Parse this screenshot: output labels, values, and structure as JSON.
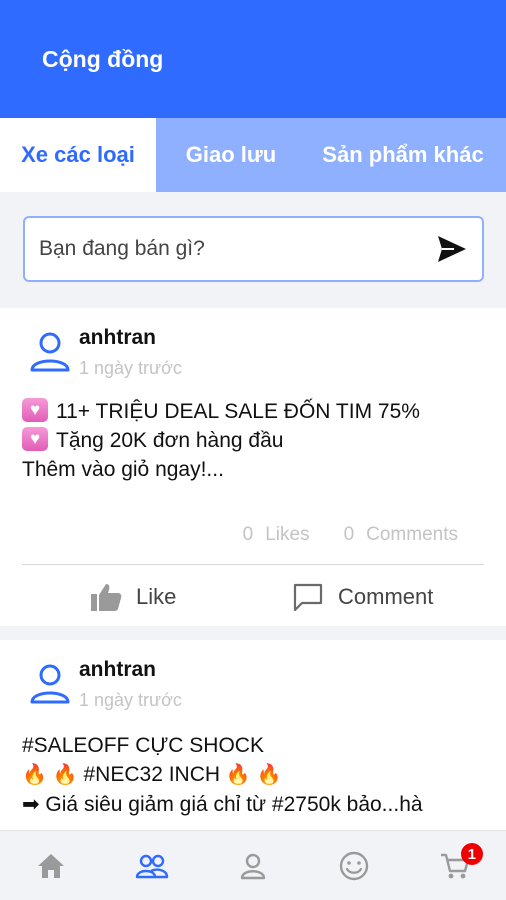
{
  "header": {
    "title": "Cộng đồng"
  },
  "tabs": [
    {
      "label": "Xe các loại",
      "active": true
    },
    {
      "label": "Giao lưu",
      "active": false
    },
    {
      "label": "Sản phẩm khác",
      "active": false
    }
  ],
  "composer": {
    "placeholder": "Bạn đang bán gì?",
    "send_icon": "send-icon"
  },
  "posts": [
    {
      "author": "anhtran",
      "time": "1 ngày trước",
      "lines": [
        "11+ TRIỆU DEAL SALE ĐỐN TIM 75%",
        "Tặng 20K đơn hàng đầu",
        "Thêm vào giỏ ngay!..."
      ],
      "likes_count": "0",
      "likes_label": "Likes",
      "comments_count": "0",
      "comments_label": "Comments",
      "like_action": "Like",
      "comment_action": "Comment"
    },
    {
      "author": "anhtran",
      "time": "1 ngày trước",
      "lines": [
        "#SALEOFF CỰC SHOCK",
        "#NEC32 INCH",
        "➡ Giá siêu giảm giá chỉ từ #2750k bảo...hà"
      ]
    }
  ],
  "bottom_nav": {
    "items": [
      "home-icon",
      "community-icon",
      "profile-icon",
      "smiley-icon",
      "cart-icon"
    ],
    "active_index": 1,
    "cart_badge": "1"
  },
  "colors": {
    "primary": "#2f6bff",
    "tab_inactive_bg": "#8fb0ff",
    "badge": "#e00000"
  }
}
